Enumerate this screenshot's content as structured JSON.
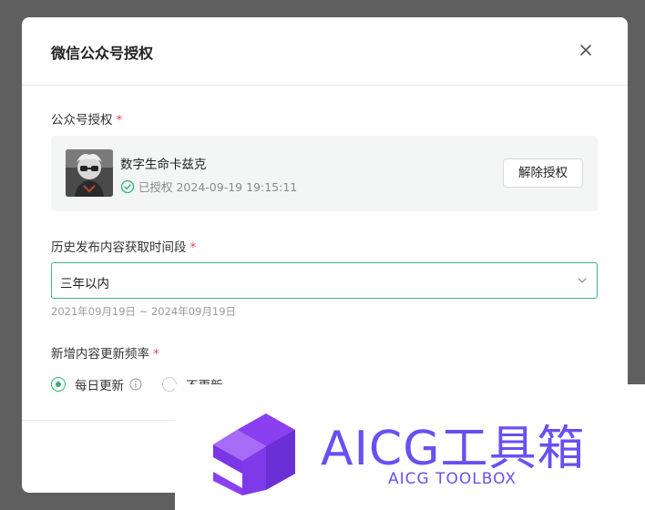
{
  "modal": {
    "title": "微信公众号授权",
    "close_icon": "close-icon"
  },
  "authorization": {
    "label": "公众号授权",
    "required_mark": "*",
    "account_name": "数字生命卡兹克",
    "status_text": "已授权 2024-09-19 19:15:11",
    "status_icon": "check-circle-icon",
    "revoke_label": "解除授权"
  },
  "history": {
    "label": "历史发布内容获取时间段",
    "required_mark": "*",
    "selected": "三年以内",
    "range_hint": "2021年09月19日 ~ 2024年09月19日"
  },
  "frequency": {
    "label": "新增内容更新频率",
    "required_mark": "*",
    "options": [
      {
        "label": "每日更新",
        "selected": true
      },
      {
        "label": "不更新",
        "selected": false
      }
    ]
  },
  "watermark": {
    "title": "AICG工具箱",
    "subtitle": "AICG TOOLBOX"
  },
  "colors": {
    "accent": "#2fb073",
    "required": "#e5484d",
    "watermark": "#6a4ff2"
  }
}
